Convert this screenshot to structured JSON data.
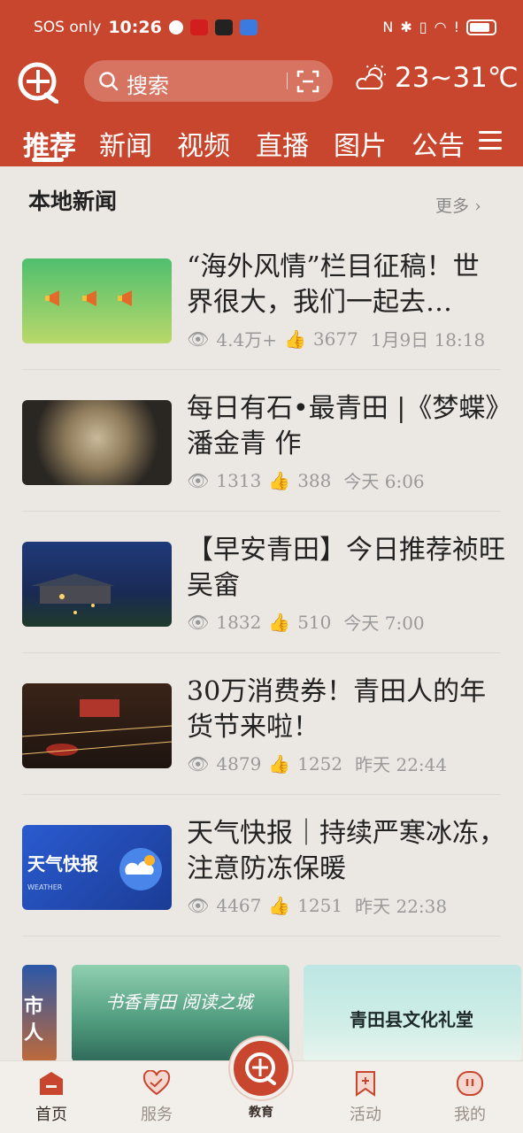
{
  "status_bar": {
    "carrier": "SOS only",
    "time": "10:26"
  },
  "header": {
    "search_placeholder": "搜索",
    "weather_temp": "23~31℃"
  },
  "tabs": [
    {
      "label": "推荐"
    },
    {
      "label": "新闻"
    },
    {
      "label": "视频"
    },
    {
      "label": "直播"
    },
    {
      "label": "图片"
    },
    {
      "label": "公告"
    }
  ],
  "section": {
    "title": "本地新闻",
    "more": "更多"
  },
  "news": [
    {
      "title": "“海外风情”栏目征稿！世界很大，我们一起去…",
      "views": "4.4万+",
      "likes": "3677",
      "time": "1月9日  18:18"
    },
    {
      "title": "每日有石•最青田 |《梦蝶》潘金青  作",
      "views": "1313",
      "likes": "388",
      "time": "今天  6:06"
    },
    {
      "title": "【早安青田】今日推荐祯旺吴畲",
      "views": "1832",
      "likes": "510",
      "time": "今天  7:00"
    },
    {
      "title": "30万消费券！青田人的年货节来啦！",
      "views": "4879",
      "likes": "1252",
      "time": "昨天  22:44"
    },
    {
      "title": "天气快报｜持续严寒冰冻，注意防冻保暖",
      "views": "4467",
      "likes": "1251",
      "time": "昨天  22:38"
    }
  ],
  "thumb_texts": {
    "weather_banner": "天气快报",
    "weather_sub": "WEATHER"
  },
  "banners": [
    {
      "text": "市人"
    },
    {
      "text": "书香青田 阅读之城"
    },
    {
      "text": "青田县文化礼堂"
    }
  ],
  "bottom_nav": [
    {
      "label": "首页"
    },
    {
      "label": "服务"
    },
    {
      "label": "教育"
    },
    {
      "label": "活动"
    },
    {
      "label": "我的"
    }
  ],
  "colors": {
    "brand": "#c8462d",
    "background": "#ebe8e3"
  }
}
